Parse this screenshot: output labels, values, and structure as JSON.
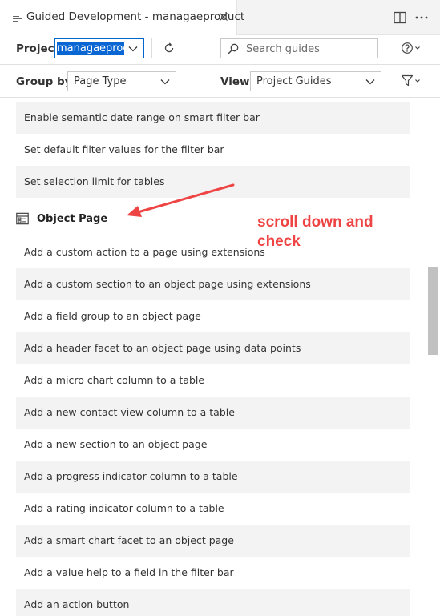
{
  "tab": {
    "title": "Guided Development - managaeproduct",
    "icon": "document-lines-icon"
  },
  "toolbar": {
    "project_label": "Project",
    "project_value": "managaeproduct",
    "search_placeholder": "Search guides",
    "group_by_label": "Group by",
    "group_by_value": "Page Type",
    "view_label": "View",
    "view_value": "Project Guides"
  },
  "list": {
    "top_items": [
      {
        "label": "Enable semantic date range on smart filter bar"
      },
      {
        "label": "Set default filter values for the filter bar"
      },
      {
        "label": "Set selection limit for tables"
      }
    ],
    "section": {
      "title": "Object Page",
      "icon": "page-layout-icon"
    },
    "section_items": [
      {
        "label": "Add a custom action to a page using extensions"
      },
      {
        "label": "Add a custom section to an object page using extensions"
      },
      {
        "label": "Add a field group to an object page"
      },
      {
        "label": "Add a header facet to an object page using data points"
      },
      {
        "label": "Add a micro chart column to a table"
      },
      {
        "label": "Add a new contact view column to a table"
      },
      {
        "label": "Add a new section to an object page"
      },
      {
        "label": "Add a progress indicator column to a table"
      },
      {
        "label": "Add a rating indicator column to a table"
      },
      {
        "label": "Add a smart chart facet to an object page"
      },
      {
        "label": "Add a value help to a field in the filter bar"
      },
      {
        "label": "Add an action button"
      }
    ]
  },
  "annotation": {
    "line1": "scroll down and",
    "line2": "check",
    "color": "#ee4444"
  },
  "colors": {
    "accent": "#0066cc",
    "selection": "#0a66d2",
    "row_alt": "#f3f3f3"
  }
}
